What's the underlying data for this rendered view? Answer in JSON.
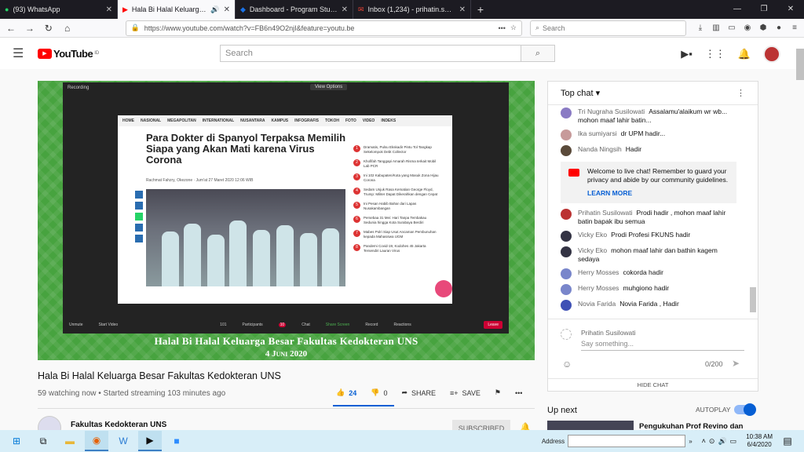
{
  "browser": {
    "tabs": [
      {
        "label": "(93) WhatsApp",
        "icon": "whatsapp-icon",
        "color": "#25d366"
      },
      {
        "label": "Hala Bi Halal Keluarga Besa",
        "icon": "youtube-icon",
        "color": "#ff0000"
      },
      {
        "label": "Dashboard - Program Studi Ke",
        "icon": "dashboard-icon",
        "color": "#1a73e8"
      },
      {
        "label": "Inbox (1,234) - prihatin.susi@st",
        "icon": "mail-icon",
        "color": "#ea4335"
      }
    ],
    "url": "https://www.youtube.com/watch?v=FB6n49O2njI&feature=youtu.be",
    "search_placeholder": "Search"
  },
  "youtube": {
    "logo": "YouTube",
    "logo_region": "ID",
    "search_placeholder": "Search"
  },
  "video": {
    "zoom_view_options": "View Options",
    "zoom_recording": "Recording",
    "article_nav": [
      "HOME",
      "NASIONAL",
      "MEGAPOLITAN",
      "INTERNATIONAL",
      "NUSANTARA",
      "KAMPUS",
      "INFOGRAFIS",
      "TOKOH",
      "FOTO",
      "VIDEO",
      "INDEKS"
    ],
    "article_title": "Para Dokter di Spanyol Terpaksa Memilih Siapa yang Akan Mati karena Virus Corona",
    "article_meta": "Rachmat Fahzry, Okezone · Jum'at 27 Maret 2020 12:06 WIB",
    "article_side": [
      "Dramatis, Pulsu Ekskadir Pintu Tol Tangkap Sekelompok Debt Collector",
      "Khofifah Tanggapi Amarah Risma terkait Mobil Lab PCR",
      "Ini 102 Kabupaten/Kota yang Masuk Zona Hijau Corona",
      "Sedam Unjuk Rasa Kematian George Floyd, Trump: Militer Dapat Dikerahkan dengan Cepat",
      "Ini Pesan Habib Bahar dari Lapas Nusakambangan",
      "Persebaa 31 Mei: Hari Tanpa Tembakau Sedunia hingga Kota Surabaya Berdiri",
      "Mabes Polri Siap Usut Ancaman Pembunuhan kepada Mahasiswa UGM",
      "Pandemi Covid-19, Kodohes 45 Jakarta Tersendiri Lauran Virus"
    ],
    "zoom_controls": [
      "Unmute",
      "Start Video",
      "Participants",
      "Chat",
      "Share Screen",
      "Record",
      "Reactions"
    ],
    "zoom_leave": "Leave",
    "zoom_participants": "101",
    "zoom_chat_badge": "10",
    "banner_line1": "Halal Bi Halal Keluarga Besar Fakultas Kedokteran UNS",
    "banner_line2": "4 Juni 2020",
    "title": "Hala Bi Halal Keluarga Besar Fakultas Kedokteran UNS",
    "meta": "59 watching now • Started streaming 103 minutes ago",
    "likes": "24",
    "dislikes": "0",
    "share_label": "SHARE",
    "save_label": "SAVE",
    "channel": "Fakultas Kedokteran UNS",
    "subscribe_label": "SUBSCRIBED"
  },
  "chat": {
    "header": "Top chat",
    "messages_top": [
      {
        "name": "Tri Nugraha Susilowati",
        "text": "Assalamu'alaikum wr wb... mohon maaf lahir batin...",
        "color": "#8a7bc4"
      },
      {
        "name": "Ika sumiyarsi",
        "text": "dr UPM hadir...",
        "color": "#c79a9a"
      },
      {
        "name": "Nanda Ningsih",
        "text": "Hadir",
        "color": "#5a4a3a"
      }
    ],
    "welcome_text": "Welcome to live chat! Remember to guard your privacy and abide by our community guidelines.",
    "learn_more": "LEARN MORE",
    "messages_bottom": [
      {
        "name": "Prihatin Susilowati",
        "text": "Prodi hadir , mohon maaf lahir batin bapak ibu semua",
        "color": "#b33"
      },
      {
        "name": "Vicky Eko",
        "text": "Prodi Profesi FKUNS hadir",
        "color": "#334"
      },
      {
        "name": "Vicky Eko",
        "text": "mohon maaf lahir dan bathin kagem sedaya",
        "color": "#334"
      },
      {
        "name": "Herry Mosses",
        "text": "cokorda hadir",
        "color": "#7986cb"
      },
      {
        "name": "Herry Mosses",
        "text": "muhgiono hadir",
        "color": "#7986cb"
      },
      {
        "name": "Novia Farida",
        "text": "Novia Farida , Hadir",
        "color": "#3f51b5"
      }
    ],
    "input_user": "Prihatin Susilowati",
    "input_placeholder": "Say something...",
    "char_count": "0/200",
    "hide_chat": "HIDE CHAT"
  },
  "upnext": {
    "label": "Up next",
    "autoplay": "AUTOPLAY",
    "next_title": "Pengukuhan Prof Revino dan"
  },
  "taskbar": {
    "address_label": "Address",
    "time": "10:38 AM",
    "date": "6/4/2020"
  }
}
